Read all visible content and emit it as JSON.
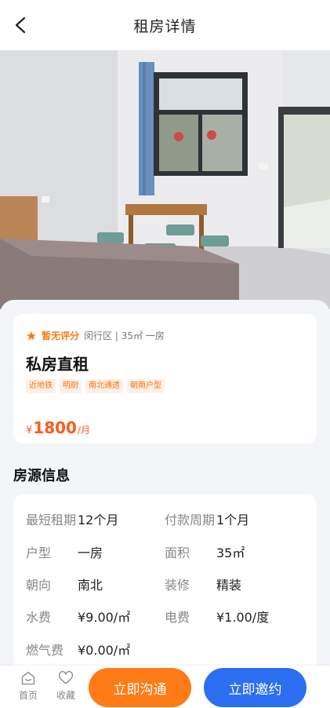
{
  "header": {
    "title": "租房详情"
  },
  "summary": {
    "rating_text": "暂无评分",
    "meta": "闵行区 | 35㎡ 一房",
    "title": "私房直租",
    "tags": [
      "近地铁",
      "明厨",
      "南北通透",
      "朝南户型"
    ],
    "price_symbol": "¥",
    "price_amount": "1800",
    "price_unit": "/月"
  },
  "section": {
    "title": "房源信息"
  },
  "info": [
    {
      "key": "最短租期",
      "value": "12个月"
    },
    {
      "key": "付款周期",
      "value": "1个月"
    },
    {
      "key": "户型",
      "value": "一房"
    },
    {
      "key": "面积",
      "value": "35㎡"
    },
    {
      "key": "朝向",
      "value": "南北"
    },
    {
      "key": "装修",
      "value": "精装"
    },
    {
      "key": "水费",
      "value": "¥9.00/㎡"
    },
    {
      "key": "电费",
      "value": "¥1.00/度"
    },
    {
      "key": "燃气费",
      "value": "¥0.00/㎡"
    }
  ],
  "bottom": {
    "home_label": "首页",
    "favorite_label": "收藏",
    "contact_label": "立即沟通",
    "invite_label": "立即邀约"
  },
  "colors": {
    "accent_orange": "#ff7b16",
    "accent_blue": "#2c6ef2",
    "price": "#ff5a1f"
  }
}
